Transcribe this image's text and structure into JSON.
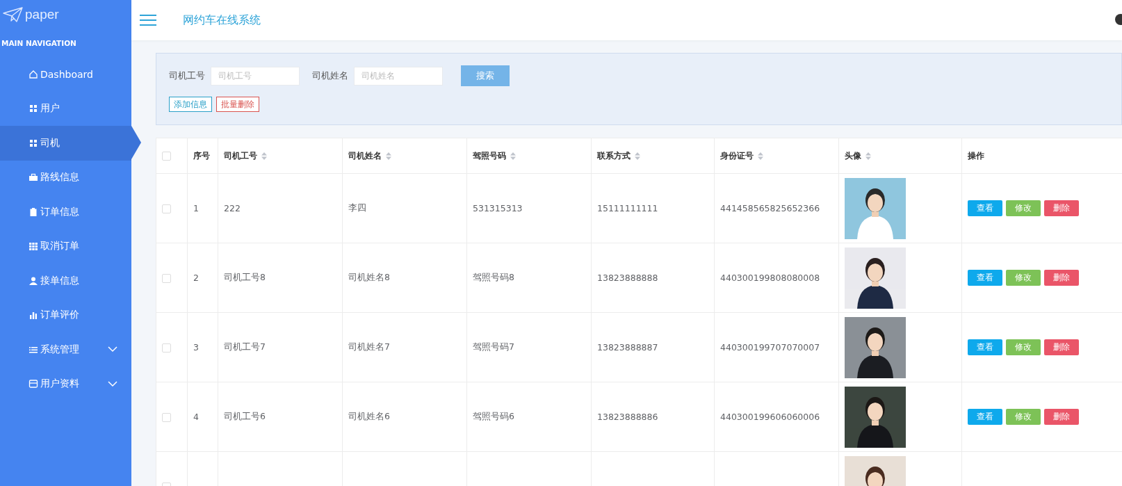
{
  "sidebar": {
    "logo": "paper",
    "section_title": "MAIN NAVIGATION",
    "items": [
      {
        "label": "Dashboard",
        "selected": false,
        "expandable": false
      },
      {
        "label": "用户",
        "selected": false,
        "expandable": false
      },
      {
        "label": "司机",
        "selected": true,
        "expandable": false
      },
      {
        "label": "路线信息",
        "selected": false,
        "expandable": false
      },
      {
        "label": "订单信息",
        "selected": false,
        "expandable": false
      },
      {
        "label": "取消订单",
        "selected": false,
        "expandable": false
      },
      {
        "label": "接单信息",
        "selected": false,
        "expandable": false
      },
      {
        "label": "订单评价",
        "selected": false,
        "expandable": false
      },
      {
        "label": "系统管理",
        "selected": false,
        "expandable": true
      },
      {
        "label": "用户资料",
        "selected": false,
        "expandable": true
      }
    ]
  },
  "header": {
    "title": "网约车在线系统"
  },
  "search": {
    "fields": [
      {
        "label": "司机工号",
        "placeholder": "司机工号"
      },
      {
        "label": "司机姓名",
        "placeholder": "司机姓名"
      }
    ],
    "search_button": "搜索",
    "add_button": "添加信息",
    "batch_delete_button": "批量删除"
  },
  "table": {
    "select_all_checked": false,
    "columns": [
      {
        "label": "序号",
        "sortable": false
      },
      {
        "label": "司机工号",
        "sortable": true
      },
      {
        "label": "司机姓名",
        "sortable": true
      },
      {
        "label": "驾照号码",
        "sortable": true
      },
      {
        "label": "联系方式",
        "sortable": true
      },
      {
        "label": "身份证号",
        "sortable": true
      },
      {
        "label": "头像",
        "sortable": true
      },
      {
        "label": "操作",
        "sortable": false
      }
    ],
    "rows": [
      {
        "checked": false,
        "cells": [
          "1",
          "222",
          "李四",
          "531315313",
          "15111111111",
          "441458565825652366"
        ],
        "actions": [
          {
            "kind": "view",
            "label": "查看"
          },
          {
            "kind": "edit",
            "label": "修改"
          },
          {
            "kind": "delete",
            "label": "删除"
          }
        ]
      },
      {
        "checked": false,
        "cells": [
          "2",
          "司机工号8",
          "司机姓名8",
          "驾照号码8",
          "13823888888",
          "440300199808080008"
        ],
        "actions": [
          {
            "kind": "view",
            "label": "查看"
          },
          {
            "kind": "edit",
            "label": "修改"
          },
          {
            "kind": "delete",
            "label": "删除"
          }
        ]
      },
      {
        "checked": false,
        "cells": [
          "3",
          "司机工号7",
          "司机姓名7",
          "驾照号码7",
          "13823888887",
          "440300199707070007"
        ],
        "actions": [
          {
            "kind": "view",
            "label": "查看"
          },
          {
            "kind": "edit",
            "label": "修改"
          },
          {
            "kind": "delete",
            "label": "删除"
          }
        ]
      },
      {
        "checked": false,
        "cells": [
          "4",
          "司机工号6",
          "司机姓名6",
          "驾照号码6",
          "13823888886",
          "440300199606060006"
        ],
        "actions": [
          {
            "kind": "view",
            "label": "查看"
          },
          {
            "kind": "edit",
            "label": "修改"
          },
          {
            "kind": "delete",
            "label": "删除"
          }
        ]
      },
      {
        "checked": false,
        "cells": [],
        "actions": []
      }
    ]
  }
}
